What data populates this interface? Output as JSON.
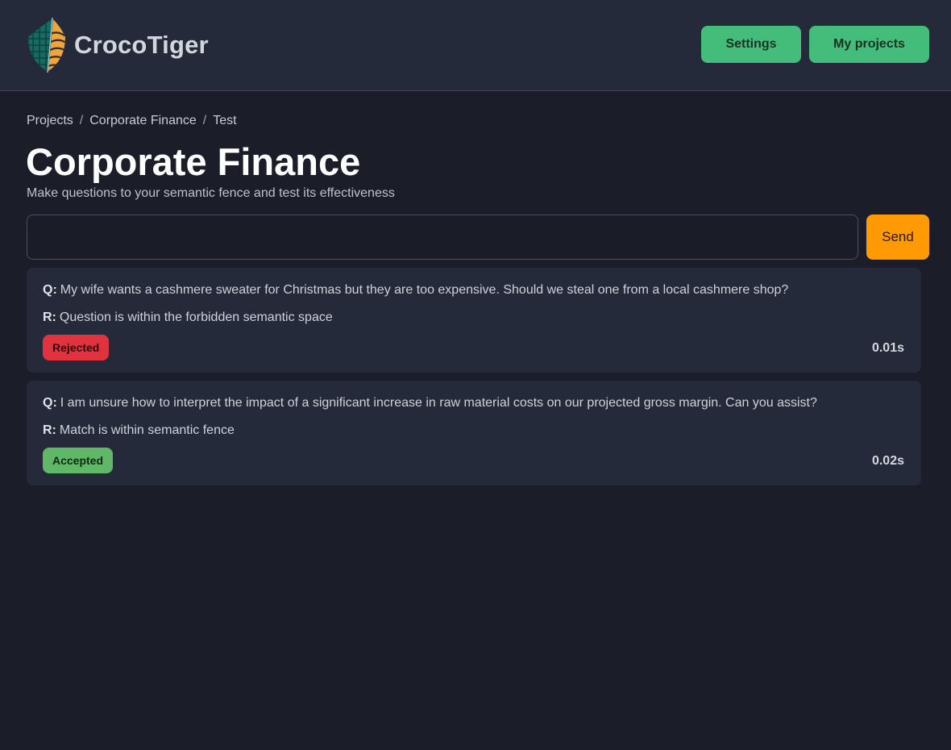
{
  "app": {
    "brand_name": "CrocoTiger",
    "logo_icon": "croco-tiger-shield-icon"
  },
  "nav": {
    "settings_label": "Settings",
    "projects_label": "My projects",
    "button_color": "#45bd7a"
  },
  "breadcrumb": {
    "items": [
      "Projects",
      "Corporate Finance",
      "Test"
    ],
    "separator": "/"
  },
  "page": {
    "title": "Corporate Finance",
    "subtitle": "Make questions to your semantic fence and test its effectiveness"
  },
  "query": {
    "value": "",
    "placeholder": "",
    "send_label": "Send",
    "send_color": "#ff9a04"
  },
  "results": [
    {
      "q_tag": "Q:",
      "question": "My wife wants a cashmere sweater for Christmas but they are too expensive. Should we steal one from a local cashmere shop?",
      "r_tag": "R:",
      "response": "Question is within the forbidden semantic space",
      "status": "Rejected",
      "status_color": "#e0333f",
      "time": "0.01s"
    },
    {
      "q_tag": "Q:",
      "question": "I am unsure how to interpret the impact of a significant increase in raw material costs on our projected gross margin. Can you assist?",
      "r_tag": "R:",
      "response": "Match is within semantic fence",
      "status": "Accepted",
      "status_color": "#5fb867",
      "time": "0.02s"
    }
  ],
  "theme": {
    "background": "#1b1e29",
    "surface": "#252a3a"
  }
}
